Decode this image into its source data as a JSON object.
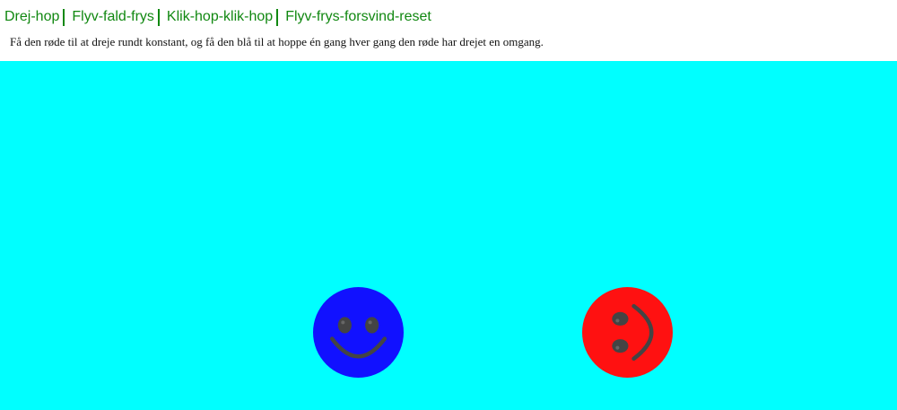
{
  "nav": {
    "links": [
      {
        "label": "Drej-hop"
      },
      {
        "label": "Flyv-fald-frys"
      },
      {
        "label": "Klik-hop-klik-hop"
      },
      {
        "label": "Flyv-frys-forsvind-reset"
      }
    ]
  },
  "instruction": "Få den røde til at dreje rundt konstant, og få den blå til at hoppe én gang hver gang den røde har drejet en omgang.",
  "stage": {
    "background": "#00ffff",
    "sprites": [
      {
        "id": "blue",
        "color": "#1111ff",
        "icon": "smiley-face-icon"
      },
      {
        "id": "red",
        "color": "#ff1111",
        "icon": "smiley-face-icon",
        "rotation_deg": -90
      }
    ]
  },
  "colors": {
    "link": "#118811",
    "face_features": "#444444"
  }
}
